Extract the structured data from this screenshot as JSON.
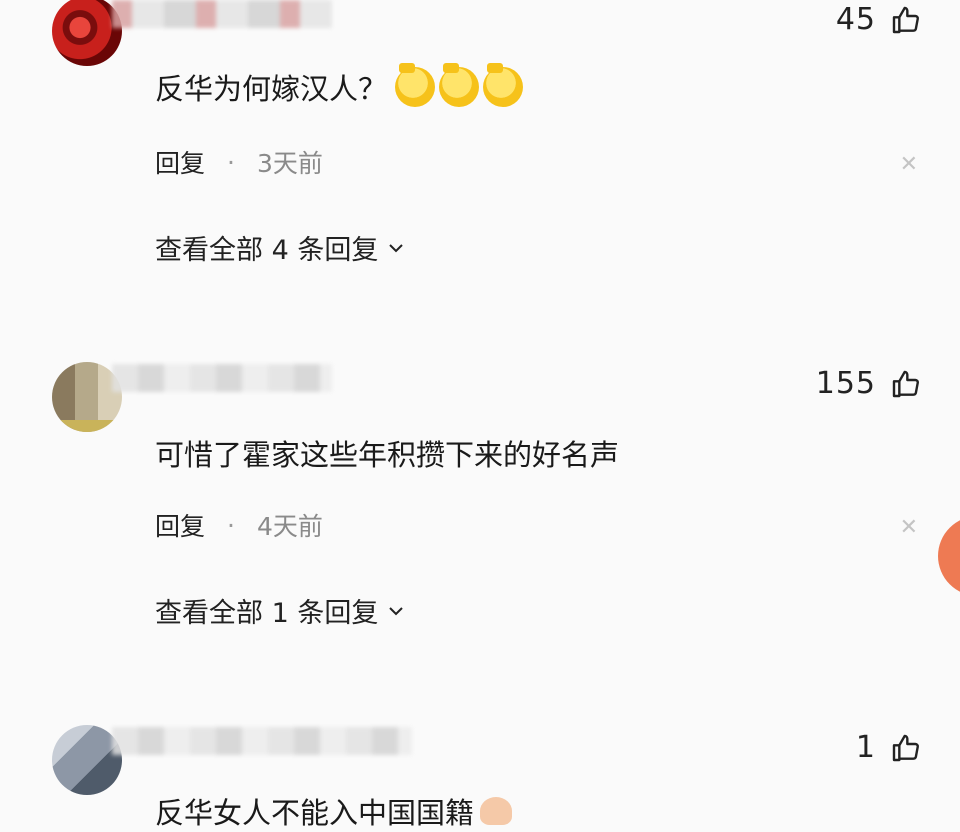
{
  "comments": [
    {
      "likes": "45",
      "text": "反华为何嫁汉人？",
      "emojis": [
        "emoji-1",
        "emoji-2",
        "emoji-3"
      ],
      "reply_label": "回复",
      "separator": "·",
      "time": "3天前",
      "view_replies": "查看全部 4 条回复"
    },
    {
      "likes": "155",
      "text": "可惜了霍家这些年积攒下来的好名声",
      "reply_label": "回复",
      "separator": "·",
      "time": "4天前",
      "view_replies": "查看全部 1 条回复"
    },
    {
      "likes": "1",
      "text": "反华女人不能入中国国籍"
    }
  ],
  "icons": {
    "like": "thumbs-up-icon",
    "close": "close-icon",
    "chevron": "chevron-down-icon"
  },
  "colors": {
    "background": "#fafafa",
    "text": "#222222",
    "muted": "#8a8a8a",
    "accent": "#ee7a53"
  }
}
